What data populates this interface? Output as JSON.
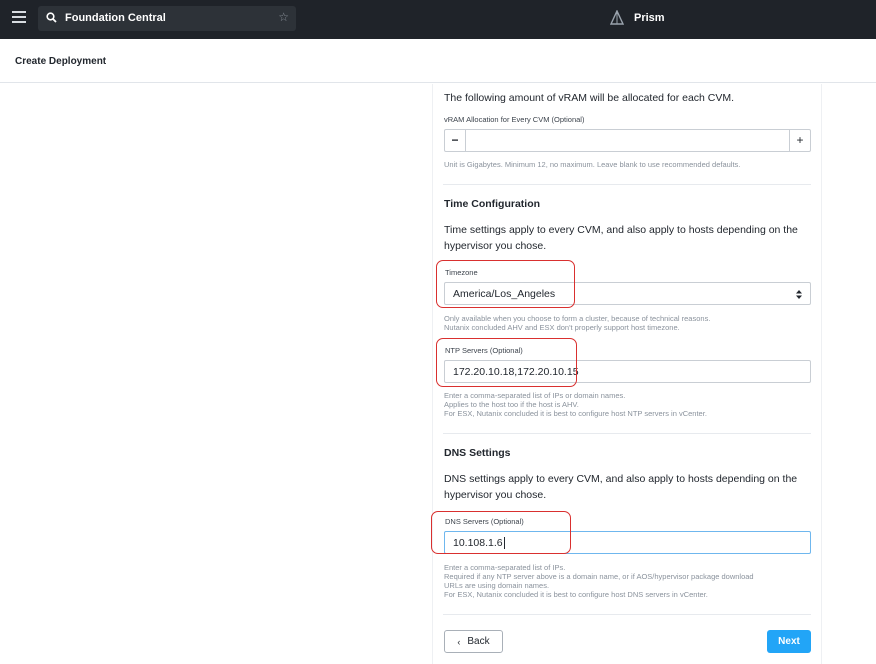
{
  "topbar": {
    "app_title": "Foundation Central",
    "brand_label": "Prism",
    "icons": [
      "menu-icon",
      "search-icon",
      "star-icon",
      "prism-logo-icon"
    ]
  },
  "header": {
    "page_title": "Create Deployment"
  },
  "vram": {
    "intro": "The following amount of vRAM will be allocated for each CVM.",
    "label": "vRAM Allocation for Every CVM (Optional)",
    "value": "",
    "minus_label": "−",
    "plus_label": "+",
    "hint": "Unit is Gigabytes. Minimum 12, no maximum. Leave blank to use recommended defaults."
  },
  "time": {
    "heading": "Time Configuration",
    "desc_line1": "Time settings apply to every CVM, and also apply to hosts depending on the",
    "desc_line2": "hypervisor you chose.",
    "timezone_label": "Timezone",
    "timezone_value": "America/Los_Angeles",
    "timezone_hint_line1": "Only available when you choose to form a cluster, because of technical reasons.",
    "timezone_hint_line2": "Nutanix concluded AHV and ESX don't properly support host timezone.",
    "ntp_label": "NTP Servers (Optional)",
    "ntp_value": "172.20.10.18,172.20.10.15",
    "ntp_hint_line1": "Enter a comma-separated list of IPs or domain names.",
    "ntp_hint_line2": "Applies to the host too if the host is AHV.",
    "ntp_hint_line3": "For ESX, Nutanix concluded it is best to configure host NTP servers in vCenter."
  },
  "dns": {
    "heading": "DNS Settings",
    "desc_line1": "DNS settings apply to every CVM, and also apply to hosts depending on the",
    "desc_line2": "hypervisor you chose.",
    "label": "DNS Servers (Optional)",
    "value": "10.108.1.6",
    "hint_line1": "Enter a comma-separated list of IPs.",
    "hint_line2": "Required if any NTP server above is a domain name, or if AOS/hypervisor package download",
    "hint_line3": "URLs are using domain names.",
    "hint_line4": "For ESX, Nutanix concluded it is best to configure host DNS servers in vCenter."
  },
  "footer": {
    "back_label": "Back",
    "next_label": "Next"
  },
  "colors": {
    "topbar": "#1f2329",
    "accent": "#22a5f7",
    "annotation": "#d9302f",
    "focus": "#6fb7ee"
  }
}
